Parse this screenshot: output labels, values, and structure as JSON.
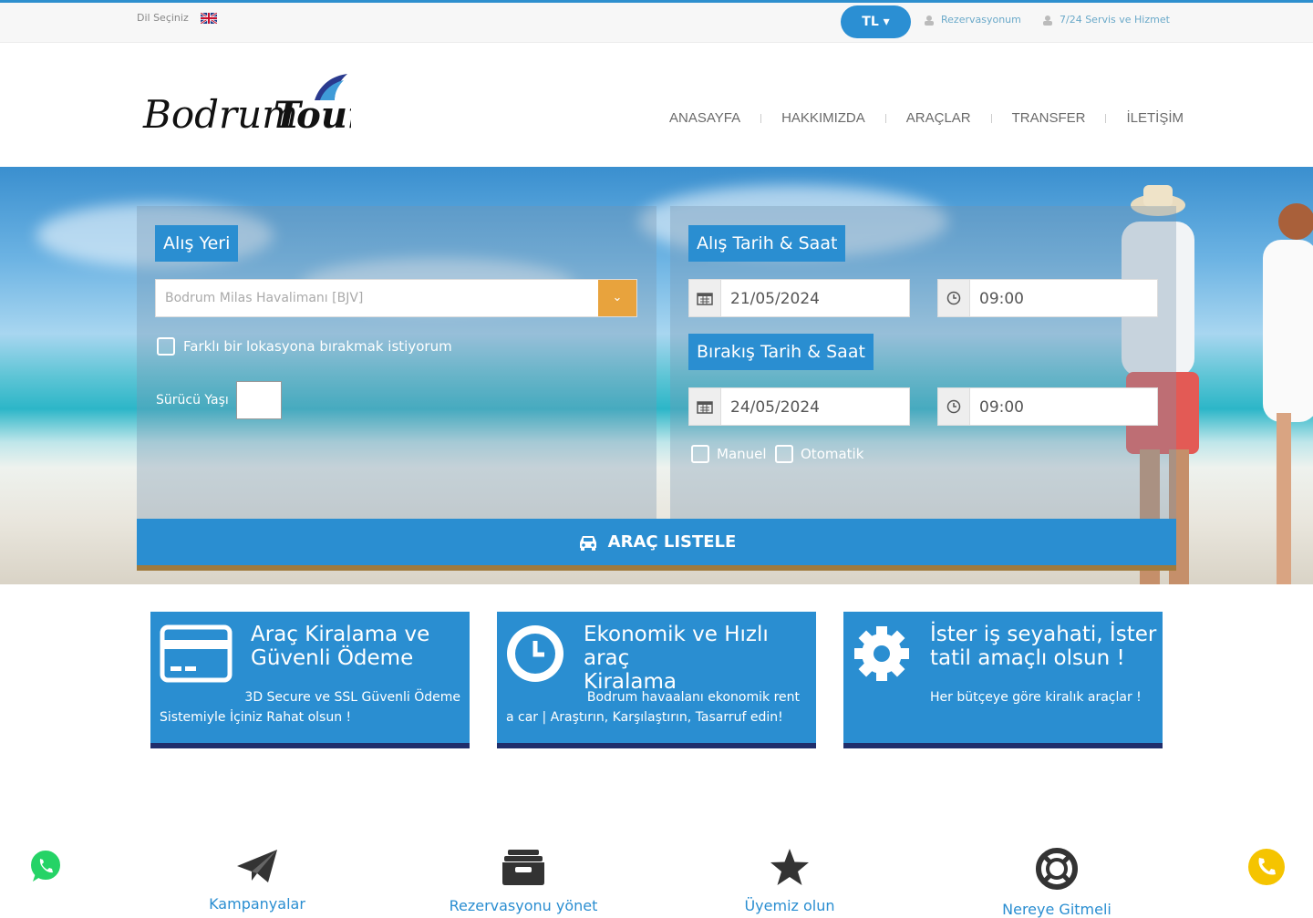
{
  "topbar": {
    "language_label": "Dil Seçiniz",
    "flag_icon": "uk-flag-icon",
    "currency": "TL",
    "links": [
      {
        "label": "Rezervasyonum",
        "icon": "user-icon"
      },
      {
        "label": "7/24 Servis ve Hizmet",
        "icon": "support-icon"
      }
    ]
  },
  "header": {
    "logo": {
      "part1": "Bodrum",
      "part2": "Tour"
    },
    "nav": [
      "ANASAYFA",
      "HAKKIMIZDA",
      "ARAÇLAR",
      "TRANSFER",
      "İLETİŞİM"
    ]
  },
  "search": {
    "pickup_title": "Alış Yeri",
    "pickup_value": "Bodrum Milas Havalimanı [BJV]",
    "different_location_label": "Farklı bir lokasyona bırakmak istiyorum",
    "driver_age_label": "Sürücü Yaşı",
    "driver_age_value": "",
    "pickup_datetime_title": "Alış Tarih & Saat",
    "pickup_date": "21/05/2024",
    "pickup_time": "09:00",
    "dropoff_datetime_title": "Bırakış Tarih & Saat",
    "dropoff_date": "24/05/2024",
    "dropoff_time": "09:00",
    "transmission": [
      "Manuel",
      "Otomatik"
    ],
    "submit_label": "ARAÇ LISTELE"
  },
  "features": [
    {
      "title_line1": "Araç Kiralama ve",
      "title_line2": "Güvenli Ödeme",
      "text_line1": "3D Secure ve SSL Güvenli Ödeme",
      "text_line2": "Sistemiyle İçiniz Rahat olsun !",
      "icon": "credit-card-icon"
    },
    {
      "title_line1": "Ekonomik ve Hızlı araç",
      "title_line2": "Kiralama",
      "text_line1": "Bodrum havaalanı ekonomik rent",
      "text_line2": "a car | Araştırın, Karşılaştırın, Tasarruf edin!",
      "icon": "clock-icon"
    },
    {
      "title_line1": "İster iş seyahati, İster",
      "title_line2": "tatil amaçlı olsun !",
      "text_line1": "Her bütçeye göre kiralık araçlar !",
      "text_line2": "",
      "icon": "gear-icon"
    }
  ],
  "bottom_links": [
    {
      "label": "Kampanyalar",
      "icon": "paper-plane-icon"
    },
    {
      "label": "Rezervasyonu yönet",
      "icon": "archive-icon"
    },
    {
      "label": "Üyemiz olun",
      "icon": "star-icon"
    },
    {
      "label": "Nereye Gitmeli",
      "icon": "lifebuoy-icon"
    }
  ],
  "colors": {
    "primary": "#2a8ed1",
    "accent": "#e8a33d",
    "dark_border": "#1f2e6b",
    "whatsapp": "#25d366",
    "phone": "#f5c400"
  }
}
